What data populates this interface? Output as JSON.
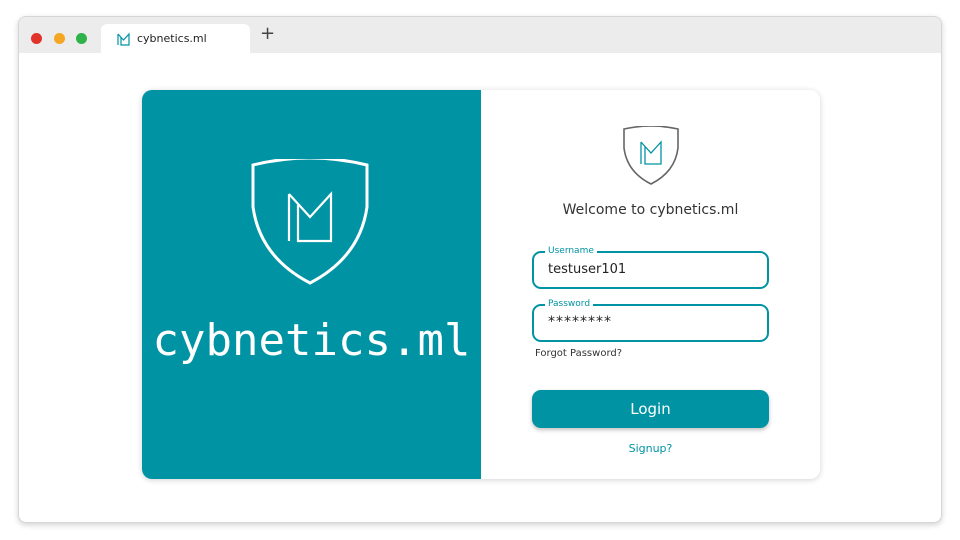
{
  "browser": {
    "tab_title": "cybnetics.ml",
    "tab_icon": "logo-icon",
    "new_tab_label": "+"
  },
  "brand": {
    "name": "cybnetics.ml",
    "color": "#0093a3"
  },
  "login": {
    "welcome": "Welcome to cybnetics.ml",
    "username_label": "Username",
    "username_value": "testuser101",
    "password_label": "Password",
    "password_value": "********",
    "forgot_label": "Forgot Password?",
    "login_label": "Login",
    "signup_label": "Signup?"
  }
}
